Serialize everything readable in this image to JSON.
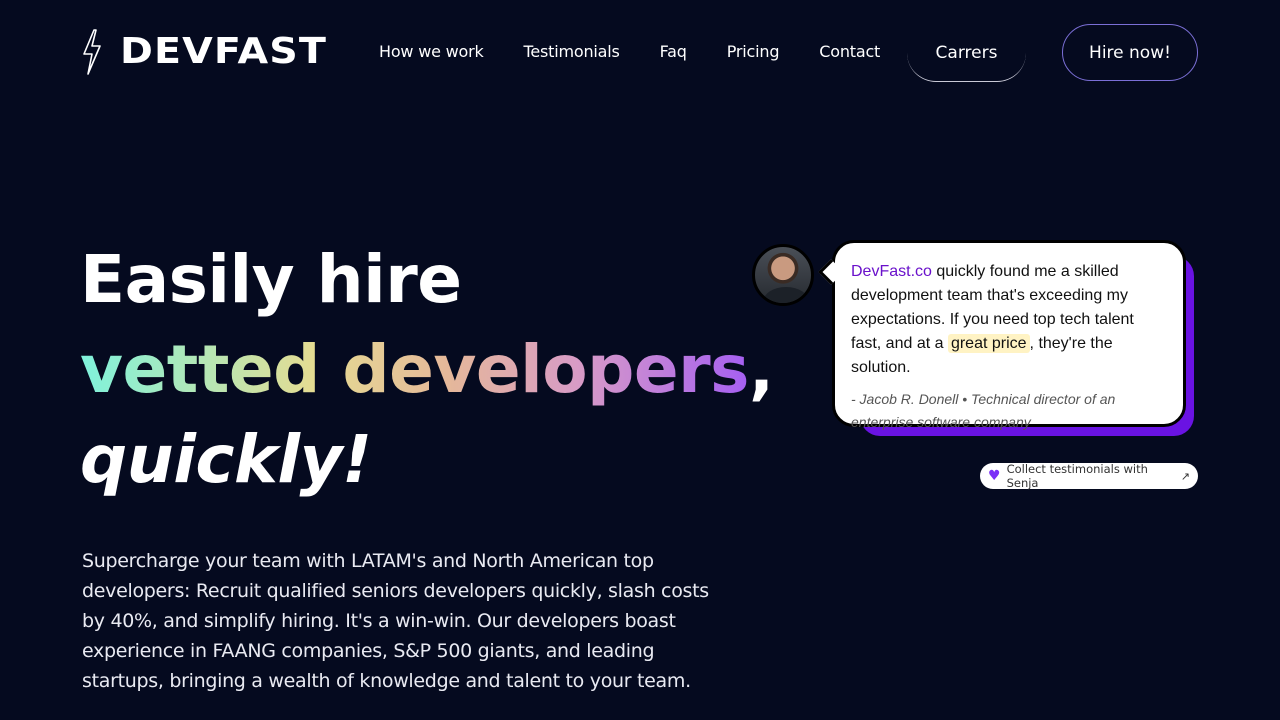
{
  "header": {
    "logo_text": "DEVFAST",
    "nav": [
      "How we work",
      "Testimonials",
      "Faq",
      "Pricing",
      "Contact"
    ],
    "careers_label": "Carrers",
    "hire_label": "Hire now!"
  },
  "hero": {
    "line1": "Easily hire",
    "line2_gradient": "vetted developers",
    "line2_suffix": ",",
    "line3": "quickly!",
    "description": "Supercharge your team with LATAM's and North American top developers: Recruit qualified seniors developers quickly, slash costs by 40%, and simplify hiring. It's a win-win. Our developers boast experience in FAANG companies, S&P 500 giants, and leading startups, bringing a wealth of knowledge and talent to your team."
  },
  "testimonial": {
    "brand": "DevFast.co",
    "text_part1": " quickly found me a skilled development team that's exceeding my expectations. If you need top tech talent fast, and at a ",
    "highlight": "great price",
    "text_part2": ", they're the solution.",
    "attribution": "- Jacob R. Donell • Technical director of an enterprise software company"
  },
  "senja": {
    "label": "Collect testimonials with Senja",
    "heart_icon": "heart-icon",
    "arrow_icon": "external-arrow-icon"
  },
  "colors": {
    "background": "#050a1f",
    "accent_purple": "#6a13e3",
    "brand_link": "#6a11cb",
    "highlight_bg": "#fff3c4"
  }
}
